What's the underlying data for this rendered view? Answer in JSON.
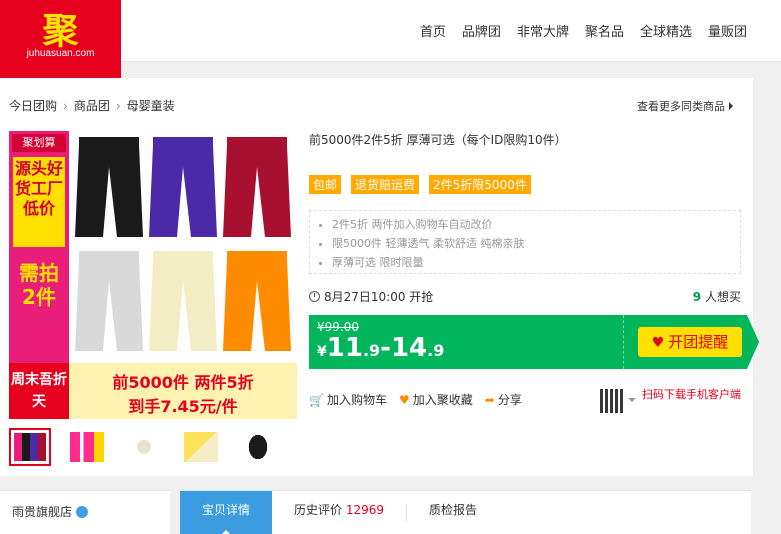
{
  "logo": {
    "glyph": "聚",
    "url": "juhuasuan.com"
  },
  "nav": [
    "首页",
    "品牌团",
    "非常大牌",
    "聚名品",
    "全球精选",
    "量贩团"
  ],
  "breadcrumb": [
    "今日团购",
    "商品团",
    "母婴童装"
  ],
  "breadcrumb_sep": "›",
  "more_link": "查看更多同类商品",
  "product": {
    "title": "前5000件2件5折 厚薄可选（每个ID限购10件）",
    "tags": [
      "包邮",
      "退货赔运费",
      "2件5折限5000件"
    ],
    "features": [
      "2件5折 两件加入购物车自动改价",
      "限5000件 轻薄透气 柔软舒适 纯棉亲肤",
      "厚薄可选 限时限量"
    ],
    "start_time": "8月27日10:00 开抢",
    "want_count": "9",
    "want_label": "人想买",
    "price_original": "¥99.00",
    "price_symbol": "¥",
    "price_low_int": "11",
    "price_low_dec": ".9",
    "price_dash": "-",
    "price_high_int": "14",
    "price_high_dec": ".9",
    "remind_button": "开团提醒"
  },
  "image": {
    "brand_tag": "聚划算",
    "side_text1": "源头好货工厂低价",
    "side_text2": "需拍2件",
    "weekend": "周末吾折天",
    "promo_line1": "前5000件 两件5折",
    "promo_line2": "到手7.45元/件"
  },
  "actions": {
    "cart": "加入购物车",
    "favorite": "加入聚收藏",
    "share": "分享"
  },
  "qr_text": "扫码下载手机客户端",
  "shop": {
    "name": "雨贵旗舰店"
  },
  "tabs": [
    {
      "label": "宝贝详情"
    },
    {
      "label": "历史评价",
      "count": "12969"
    },
    {
      "label": "质检报告"
    }
  ],
  "colors": {
    "brand_red": "#e5001e",
    "price_green": "#00b55b",
    "tag_orange": "#ffaa00",
    "tab_blue": "#3c9ce0"
  }
}
